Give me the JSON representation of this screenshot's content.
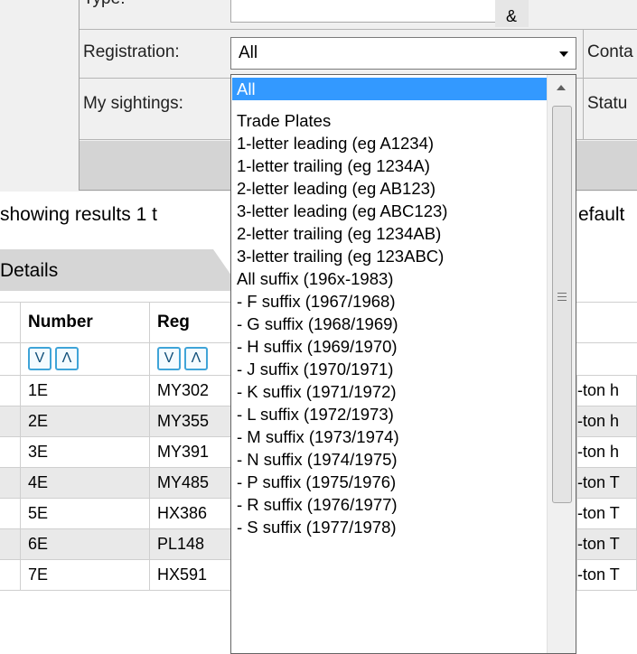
{
  "form": {
    "type_label": "Type:",
    "amp": "&",
    "registration_label": "Registration:",
    "registration_value": "All",
    "sightings_label": "My sightings:",
    "right_label_1": "Conta",
    "right_label_2": "Statu"
  },
  "results": {
    "showing_text": "showing results 1 t",
    "default_text": "efault"
  },
  "tab": {
    "label": "Details"
  },
  "table": {
    "headers": {
      "number": "Number",
      "reg": "Reg"
    },
    "sort_down": "V",
    "sort_up": "Λ",
    "rows": [
      {
        "number": "1E",
        "reg": "MY302",
        "desc": "-ton h"
      },
      {
        "number": "2E",
        "reg": "MY355",
        "desc": "-ton h"
      },
      {
        "number": "3E",
        "reg": "MY391",
        "desc": "-ton h"
      },
      {
        "number": "4E",
        "reg": "MY485",
        "desc": "-ton T"
      },
      {
        "number": "5E",
        "reg": "HX386",
        "desc": "-ton T"
      },
      {
        "number": "6E",
        "reg": "PL148",
        "desc": "-ton T"
      },
      {
        "number": "7E",
        "reg": "HX591",
        "desc": "-ton T"
      }
    ]
  },
  "dropdown": {
    "options": [
      "All",
      "Trade Plates",
      "1-letter leading (eg A1234)",
      "1-letter trailing (eg 1234A)",
      "2-letter leading (eg AB123)",
      "3-letter leading (eg ABC123)",
      "2-letter trailing (eg 1234AB)",
      "3-letter trailing (eg 123ABC)",
      "All suffix (196x-1983)",
      "- F suffix (1967/1968)",
      "- G suffix (1968/1969)",
      "- H suffix (1969/1970)",
      "- J suffix (1970/1971)",
      "- K suffix (1971/1972)",
      "- L suffix (1972/1973)",
      "- M suffix (1973/1974)",
      "- N suffix (1974/1975)",
      "- P suffix (1975/1976)",
      "- R suffix (1976/1977)",
      "- S suffix (1977/1978)"
    ],
    "selected_index": 0
  },
  "colors": {
    "selection": "#3399ff",
    "sort_button_border": "#3fa4d8"
  }
}
